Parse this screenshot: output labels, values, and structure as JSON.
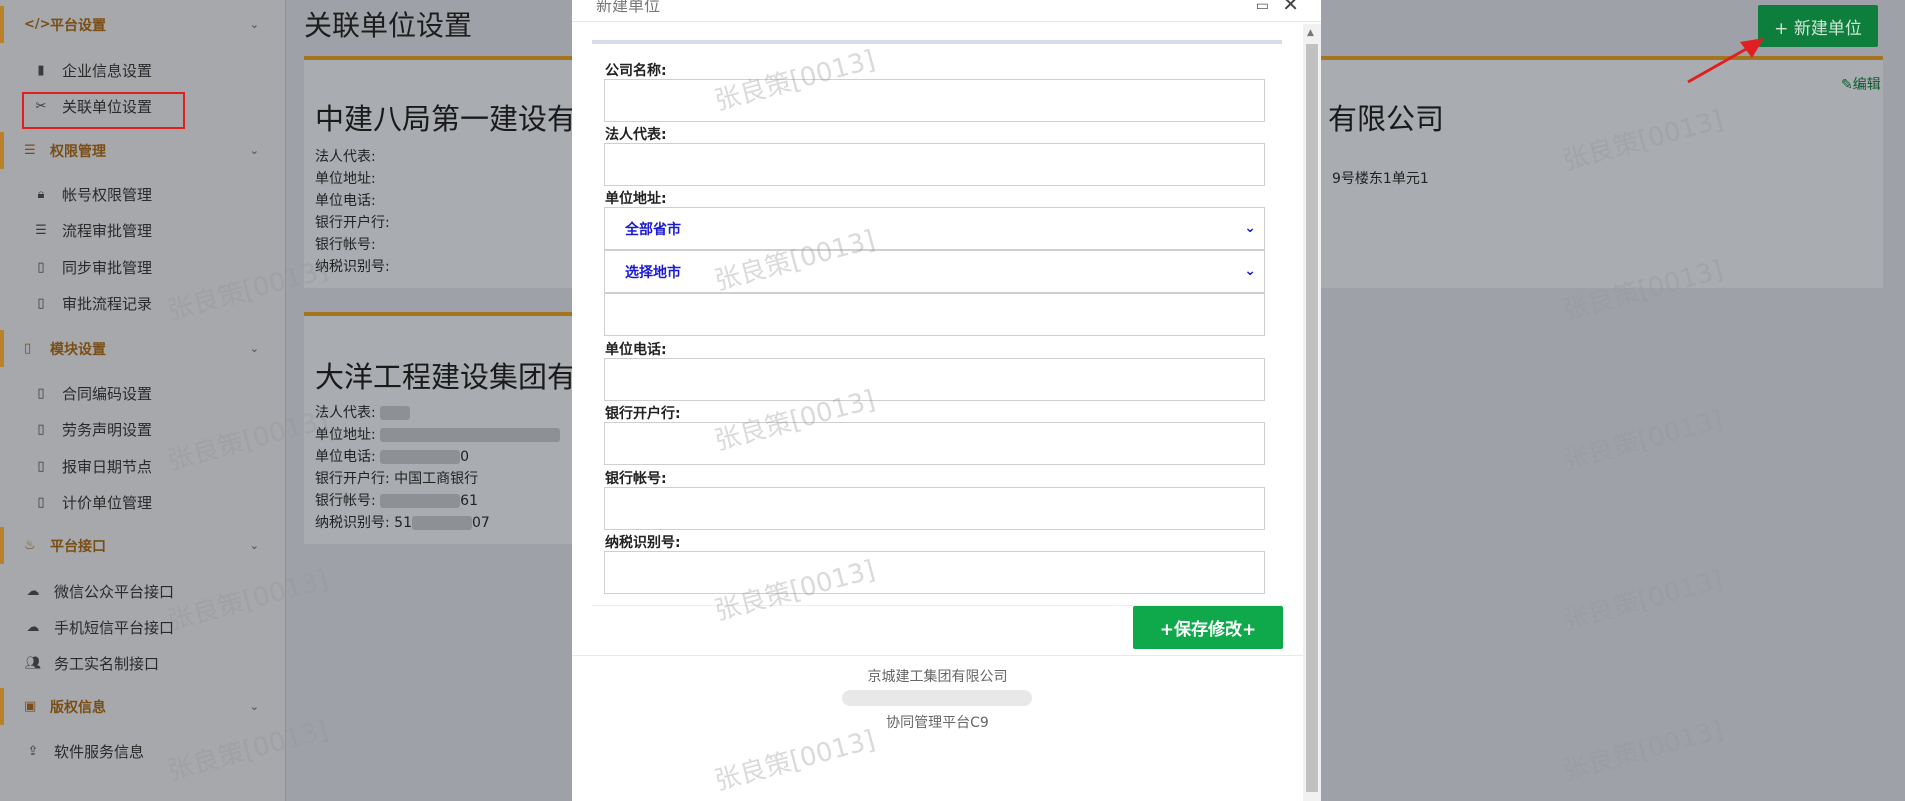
{
  "sidebar": {
    "sections": [
      {
        "title": "平台设置",
        "icon": "code-icon",
        "items": [
          {
            "label": "企业信息设置",
            "icon": "building-icon"
          },
          {
            "label": "关联单位设置",
            "icon": "link-icon"
          }
        ]
      },
      {
        "title": "权限管理",
        "icon": "list-icon",
        "items": [
          {
            "label": "帐号权限管理",
            "icon": "lock-icon"
          },
          {
            "label": "流程审批管理",
            "icon": "list-icon"
          },
          {
            "label": "同步审批管理",
            "icon": "file-icon"
          },
          {
            "label": "审批流程记录",
            "icon": "file-icon"
          }
        ]
      },
      {
        "title": "模块设置",
        "icon": "file-icon",
        "items": [
          {
            "label": "合同编码设置",
            "icon": "file-icon"
          },
          {
            "label": "劳务声明设置",
            "icon": "file-icon"
          },
          {
            "label": "报审日期节点",
            "icon": "file-icon"
          },
          {
            "label": "计价单位管理",
            "icon": "file-icon"
          }
        ]
      },
      {
        "title": "平台接口",
        "icon": "weibo-icon",
        "items": [
          {
            "label": "微信公众平台接口",
            "icon": "wechat-icon"
          },
          {
            "label": "手机短信平台接口",
            "icon": "wechat-icon"
          },
          {
            "label": "务工实名制接口",
            "icon": "users-icon"
          }
        ]
      },
      {
        "title": "版权信息",
        "icon": "copyright-icon",
        "items": [
          {
            "label": "软件服务信息",
            "icon": "upload-icon"
          }
        ]
      }
    ]
  },
  "main": {
    "page_title": "关联单位设置",
    "new_button": "+ 新建单位",
    "edit_label": "编辑",
    "card1": {
      "title": "中建八局第一建设有",
      "title_right": "有限公司",
      "addr_right": "9号楼东1单元1",
      "rows": [
        "法人代表:",
        "单位地址:",
        "单位电话:",
        "银行开户行:",
        "银行帐号:",
        "纳税识别号:"
      ]
    },
    "card2": {
      "title": "大洋工程建设集团有",
      "rows": [
        "法人代表:",
        "单位地址:",
        "单位电话:",
        "银行开户行:",
        "银行帐号:",
        "纳税识别号:"
      ],
      "bank": "中国工商银行",
      "phone_tail": "0",
      "account_tail": "61",
      "tax_head": "51",
      "tax_tail": "07"
    }
  },
  "modal": {
    "title": "新建单位",
    "fields": {
      "company_name": "公司名称:",
      "legal_rep": "法人代表:",
      "address": "单位地址:",
      "province_select": "全部省市",
      "city_select": "选择地市",
      "phone": "单位电话:",
      "bank": "银行开户行:",
      "account": "银行帐号:",
      "tax_id": "纳税识别号:"
    },
    "save_button": "+保存修改+",
    "footer_company": "京城建工集团有限公司",
    "footer_platform": "协同管理平台C9"
  },
  "watermark": "张良策[0013]"
}
